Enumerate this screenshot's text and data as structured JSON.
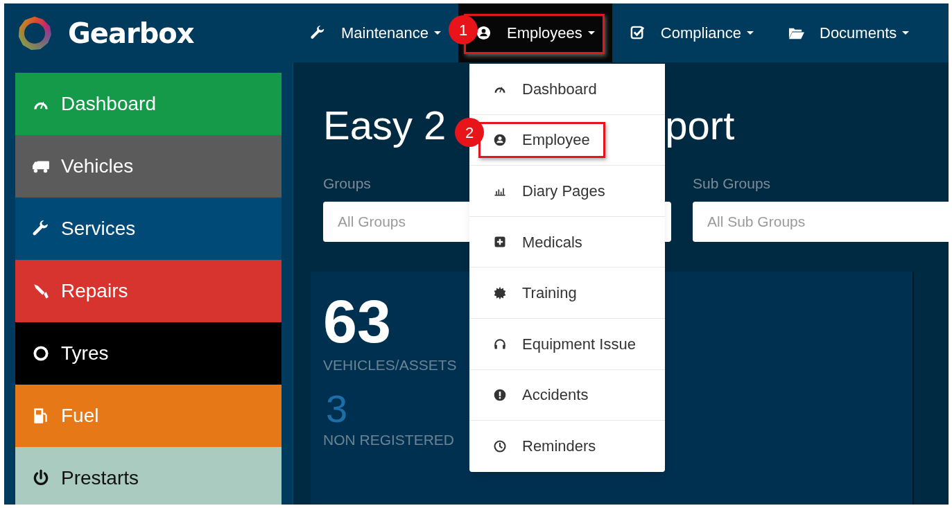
{
  "brand": {
    "name": "Gearbox"
  },
  "nav": [
    {
      "label": "Maintenance",
      "expanded": false,
      "highlighted": false
    },
    {
      "label": "Employees",
      "expanded": true,
      "highlighted": true
    },
    {
      "label": "Compliance",
      "expanded": false,
      "highlighted": false
    },
    {
      "label": "Documents",
      "expanded": false,
      "highlighted": false
    }
  ],
  "dropdown": [
    {
      "label": "Dashboard",
      "highlighted": false
    },
    {
      "label": "Employee",
      "highlighted": true
    },
    {
      "label": "Diary Pages",
      "highlighted": false
    },
    {
      "label": "Medicals",
      "highlighted": false
    },
    {
      "label": "Training",
      "highlighted": false
    },
    {
      "label": "Equipment Issue",
      "highlighted": false
    },
    {
      "label": "Accidents",
      "highlighted": false
    },
    {
      "label": "Reminders",
      "highlighted": false
    }
  ],
  "callouts": [
    {
      "label": "1"
    },
    {
      "label": "2"
    }
  ],
  "sidebar": {
    "items": [
      {
        "label": "Dashboard",
        "color": "#149a48"
      },
      {
        "label": "Vehicles",
        "color": "#5b5b5b"
      },
      {
        "label": "Services",
        "color": "#004a77"
      },
      {
        "label": "Repairs",
        "color": "#d8342f"
      },
      {
        "label": "Tyres",
        "color": "#000000"
      },
      {
        "label": "Fuel",
        "color": "#e67817"
      },
      {
        "label": "Prestarts",
        "color": "#a9cbc0"
      }
    ]
  },
  "page_title": {
    "left": "Easy 2",
    "right": "port"
  },
  "filters": [
    {
      "label": "Groups",
      "placeholder": "All Groups"
    },
    {
      "label": "Sub Groups",
      "placeholder": "All Sub Groups"
    }
  ],
  "stats": [
    {
      "kind": "primary",
      "value": "63",
      "label": "VEHICLES/ASSETS"
    },
    {
      "kind": "secondary",
      "value": "3",
      "label": "NON REGISTERED"
    }
  ]
}
